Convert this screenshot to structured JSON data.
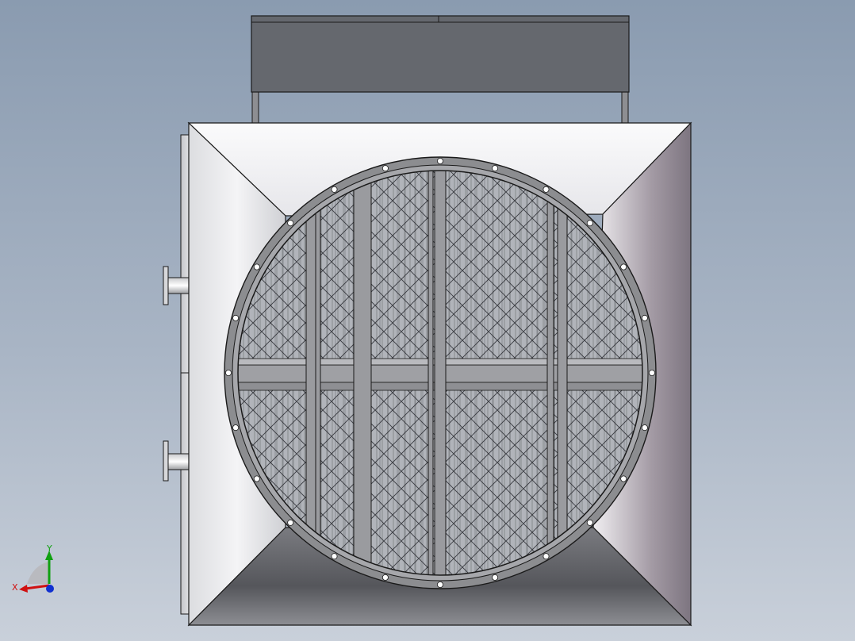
{
  "viewport": {
    "background_top": "#8a9bb0",
    "background_bottom": "#c9d0da"
  },
  "model": {
    "flange_bolt_count": 24,
    "colors": {
      "housing_light": "#f2f2f4",
      "housing_dark": "#5a5a60",
      "housing_right": "#8a7e88",
      "top_box": "#65686e",
      "flange": "#8c8d90",
      "mesh_bg": "#b3b6bc",
      "frame_bar": "#9a9b9f",
      "outline": "#1a1a1a"
    }
  },
  "triad": {
    "x_label": "X",
    "y_label": "Y",
    "x_color": "#d01010",
    "y_color": "#10a010",
    "z_color": "#1030d0"
  }
}
